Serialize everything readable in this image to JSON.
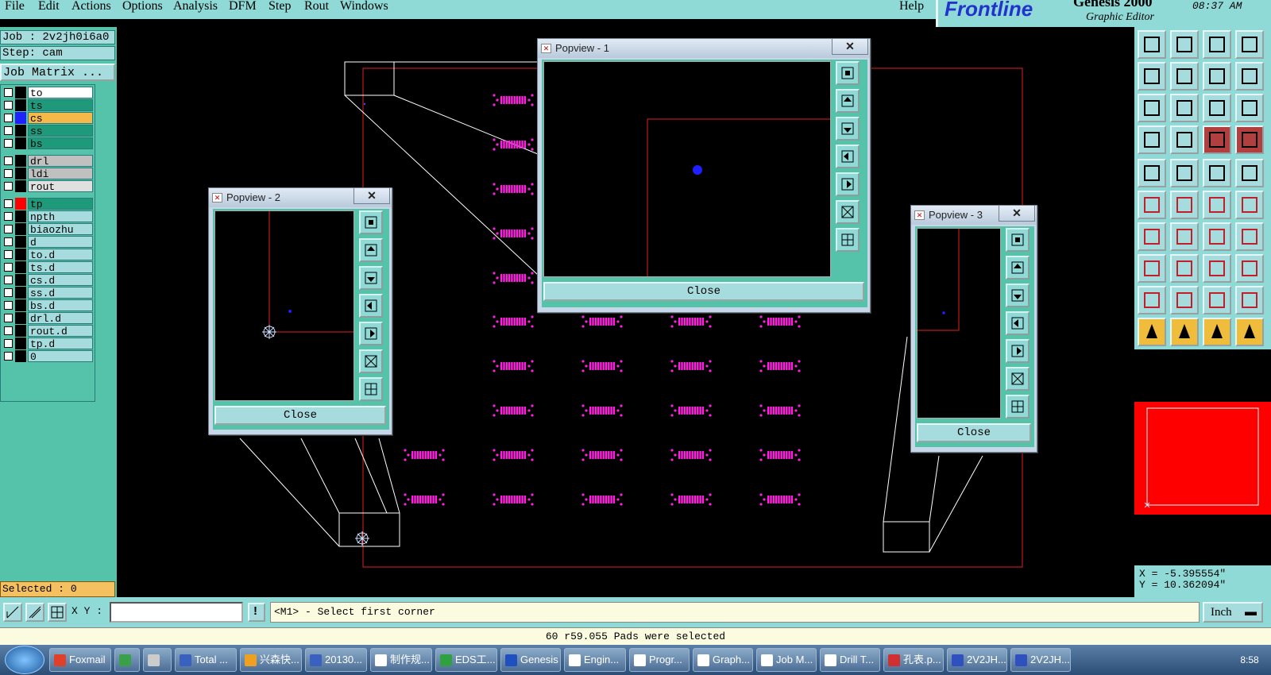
{
  "menu": {
    "items": [
      "File",
      "Edit",
      "Actions",
      "Options",
      "Analysis",
      "DFM",
      "Step",
      "Rout",
      "Windows"
    ],
    "help": "Help"
  },
  "brand": {
    "logo": "Frontline",
    "product": "Genesis 2000",
    "subtitle": "Graphic Editor",
    "time": "08:37 AM"
  },
  "job": {
    "job_label": "Job : 2v2jh0i6a0",
    "step_label": "Step: cam",
    "matrix_button": "Job Matrix ..."
  },
  "layers": [
    {
      "name": "to",
      "color": "#ffffff",
      "swatch": "#000000"
    },
    {
      "name": "ts",
      "color": "#1e9a7a",
      "swatch": "#000000"
    },
    {
      "name": "cs",
      "color": "#f5b949",
      "swatch": "#1f1fff"
    },
    {
      "name": "ss",
      "color": "#1e9a7a",
      "swatch": "#000000"
    },
    {
      "name": "bs",
      "color": "#1e9a7a",
      "swatch": "#000000"
    },
    {
      "name": "drl",
      "color": "#c0c0c0",
      "swatch": "#000000"
    },
    {
      "name": "ldi",
      "color": "#c0c0c0",
      "swatch": "#000000"
    },
    {
      "name": "rout",
      "color": "#e0e0e0",
      "swatch": "#000000"
    },
    {
      "name": "tp",
      "color": "#1e9a7a",
      "swatch": "#ff0000"
    },
    {
      "name": "npth",
      "color": "#a6dcdd",
      "swatch": "#000000"
    },
    {
      "name": "biaozhu",
      "color": "#a6dcdd",
      "swatch": "#000000"
    },
    {
      "name": "d",
      "color": "#a6dcdd",
      "swatch": "#000000"
    },
    {
      "name": "to.d",
      "color": "#a6dcdd",
      "swatch": "#000000"
    },
    {
      "name": "ts.d",
      "color": "#a6dcdd",
      "swatch": "#000000"
    },
    {
      "name": "cs.d",
      "color": "#a6dcdd",
      "swatch": "#000000"
    },
    {
      "name": "ss.d",
      "color": "#a6dcdd",
      "swatch": "#000000"
    },
    {
      "name": "bs.d",
      "color": "#a6dcdd",
      "swatch": "#000000"
    },
    {
      "name": "drl.d",
      "color": "#a6dcdd",
      "swatch": "#000000"
    },
    {
      "name": "rout.d",
      "color": "#a6dcdd",
      "swatch": "#000000"
    },
    {
      "name": "tp.d",
      "color": "#a6dcdd",
      "swatch": "#000000"
    },
    {
      "name": "0",
      "color": "#a6dcdd",
      "swatch": "#000000"
    }
  ],
  "popviews": {
    "p1": {
      "title": "Popview - 1",
      "close": "Close"
    },
    "p2": {
      "title": "Popview - 2",
      "close": "Close"
    },
    "p3": {
      "title": "Popview - 3",
      "close": "Close"
    },
    "x_glyph": "✕"
  },
  "status": {
    "selected": "Selected : 0",
    "xy_label": "X Y :",
    "xy_value": "",
    "prompt": "<M1> - Select first corner",
    "units": "Inch",
    "message": "60 r59.055 Pads were selected",
    "coord_x": "X = -5.395554\"",
    "coord_y": "Y = 10.362094\""
  },
  "colors": {
    "pad": "#ff1fe0",
    "outline": "#ff2020",
    "accent": "#8fd9d6"
  },
  "taskbar": {
    "items": [
      "Foxmail",
      "",
      "",
      "Total ...",
      "兴森快...",
      "20130...",
      "制作规...",
      "EDS工...",
      "Genesis",
      "Engin...",
      "Progr...",
      "Graph...",
      "Job M...",
      "Drill T...",
      "孔表.p...",
      "2V2JH...",
      "2V2JH..."
    ],
    "clock": "8:58"
  }
}
